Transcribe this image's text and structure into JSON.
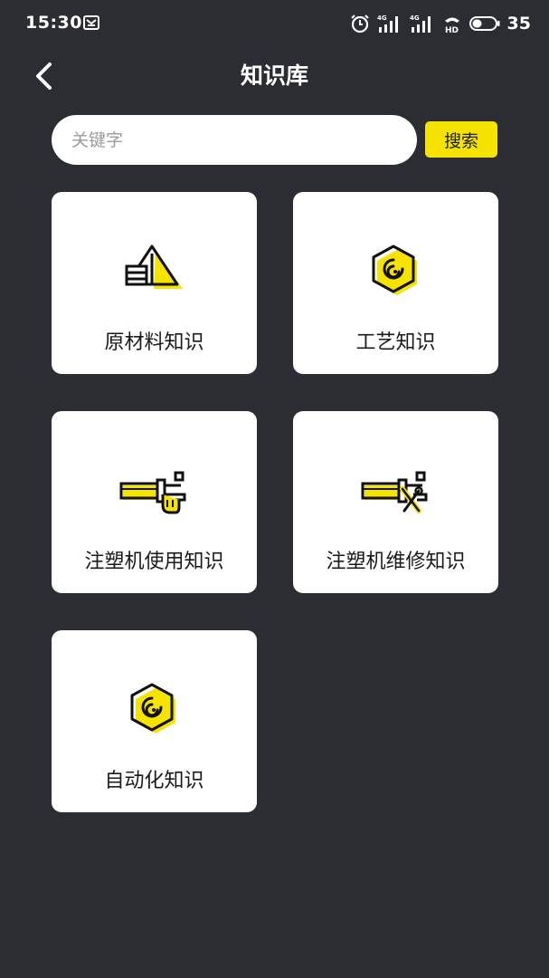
{
  "status_bar": {
    "time": "15:30",
    "network_1": "4G",
    "network_2": "4G",
    "hd_label": "HD",
    "battery": "35"
  },
  "header": {
    "title": "知识库"
  },
  "search": {
    "placeholder": "关键字",
    "value": "",
    "button_label": "搜索"
  },
  "categories": [
    {
      "label": "原材料知识",
      "icon": "raw-material-icon"
    },
    {
      "label": "工艺知识",
      "icon": "process-icon"
    },
    {
      "label": "注塑机使用知识",
      "icon": "machine-usage-icon"
    },
    {
      "label": "注塑机维修知识",
      "icon": "machine-repair-icon"
    },
    {
      "label": "自动化知识",
      "icon": "automation-icon"
    }
  ],
  "colors": {
    "background": "#2b2d33",
    "accent": "#f6e300",
    "card": "#ffffff",
    "card_text": "#1a1a1a"
  }
}
